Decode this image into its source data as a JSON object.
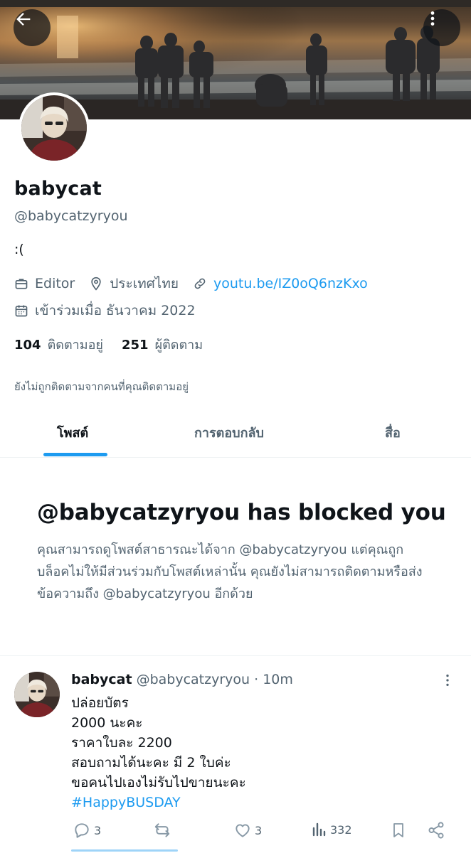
{
  "header": {
    "back_icon": "arrow-left-icon",
    "more_icon": "more-vertical-icon"
  },
  "profile": {
    "display_name": "babycat",
    "handle": "@babycatzyryou",
    "bio": ":(",
    "profession_icon": "briefcase-icon",
    "profession": "Editor",
    "location_icon": "location-pin-icon",
    "location": "ประเทศไทย",
    "link_icon": "link-icon",
    "link": "youtu.be/IZ0oQ6nzKxo",
    "joined_icon": "calendar-icon",
    "joined": "เข้าร่วมเมื่อ ธันวาคม 2022",
    "following_count": "104",
    "following_label": "ติดตามอยู่",
    "followers_count": "251",
    "followers_label": "ผู้ติดตาม",
    "not_followed_note": "ยังไม่ถูกติดตามจากคนที่คุณติดตามอยู่"
  },
  "tabs": [
    {
      "label": "โพสต์",
      "active": true
    },
    {
      "label": "การตอบกลับ",
      "active": false
    },
    {
      "label": "สื่อ",
      "active": false
    }
  ],
  "blocked": {
    "title": "@babycatzyryou has blocked you",
    "message": "คุณสามารถดูโพสต์สาธารณะได้จาก @babycatzyryou แต่คุณถูกบล็อคไม่ให้มีส่วนร่วมกับโพสต์เหล่านั้น คุณยังไม่สามารถติดตามหรือส่งข้อความถึง @babycatzyryou อีกด้วย"
  },
  "tweet": {
    "name": "babycat",
    "handle": "@babycatzyryou",
    "time": "· 10m",
    "lines": [
      "ปล่อยบัตร",
      "2000 นะคะ",
      "ราคาใบละ 2200",
      "สอบถามได้นะคะ มี 2 ใบค่ะ",
      "ขอคนไปเองไม่รับไปขายนะคะ"
    ],
    "hashtag": "#HappyBUSDAY",
    "replies": "3",
    "retweets": "",
    "likes": "3",
    "views": "332",
    "icons": [
      "reply-icon",
      "retweet-icon",
      "heart-icon",
      "views-icon",
      "bookmark-icon",
      "share-icon"
    ]
  },
  "colors": {
    "accent": "#1d9bf0",
    "text": "#0f1419",
    "secondary": "#536471"
  }
}
